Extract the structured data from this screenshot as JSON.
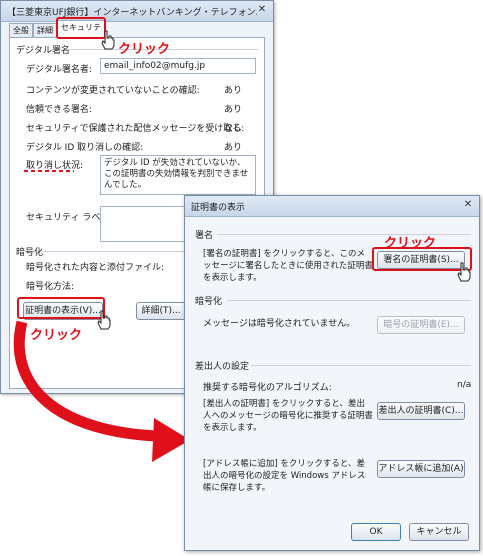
{
  "win1": {
    "title": "【三菱東京UFJ銀行】インターネットバンキング・テレフォンバンキング指定",
    "tabs": [
      "全般",
      "詳細",
      "セキュリティ"
    ],
    "group_signature": "デジタル署名",
    "signer_label": "デジタル署名者:",
    "signer_value": "email_info02@mufg.jp",
    "rows": [
      {
        "label": "コンテンツが変更されていないことの確認:",
        "value": "あり"
      },
      {
        "label": "信頼できる署名:",
        "value": "あり"
      },
      {
        "label": "セキュリティで保護された配信メッセージを受け取る:",
        "value": "なし"
      },
      {
        "label": "デジタル ID 取り消しの確認:",
        "value": "あり"
      }
    ],
    "revoke_label": "取り消し状況:",
    "revoke_text": "デジタル ID が失効されていないか、この証明書の失効情報を判別できませんでした。",
    "security_label": "セキュリティ ラベル:",
    "group_encryption": "暗号化",
    "enc_content_label": "暗号化された内容と添付ファイル:",
    "enc_method_label": "暗号化方法:",
    "btn_view_cert": "証明書の表示(V)...",
    "btn_detail": "詳細(T)..."
  },
  "win2": {
    "title": "証明書の表示",
    "sec_sign": "署名",
    "sign_desc": "[署名の証明書] をクリックすると、このメッセージに署名したときに使用された証明書を表示します。",
    "btn_sign_cert": "署名の証明書(S)...",
    "sec_enc": "暗号化",
    "enc_desc": "メッセージは暗号化されていません。",
    "btn_enc_cert": "暗号の証明書(E)...",
    "sec_sender": "差出人の設定",
    "algo_label": "推奨する暗号化のアルゴリズム:",
    "algo_value": "n/a",
    "sender_desc": "[差出人の証明書] をクリックすると、差出人へのメッセージの暗号化に推奨する証明書を表示します。",
    "btn_sender_cert": "差出人の証明書(C)...",
    "addr_desc": "[アドレス帳に追加] をクリックすると、差出人の暗号化の設定を Windows アドレス帳に保存します。",
    "btn_addr": "アドレス帳に追加(A)",
    "btn_ok": "OK",
    "btn_cancel": "キャンセル"
  },
  "annotations": {
    "click1": "クリック",
    "click2": "クリック",
    "click3": "クリック"
  },
  "colors": {
    "accent_red": "#e0101a"
  }
}
